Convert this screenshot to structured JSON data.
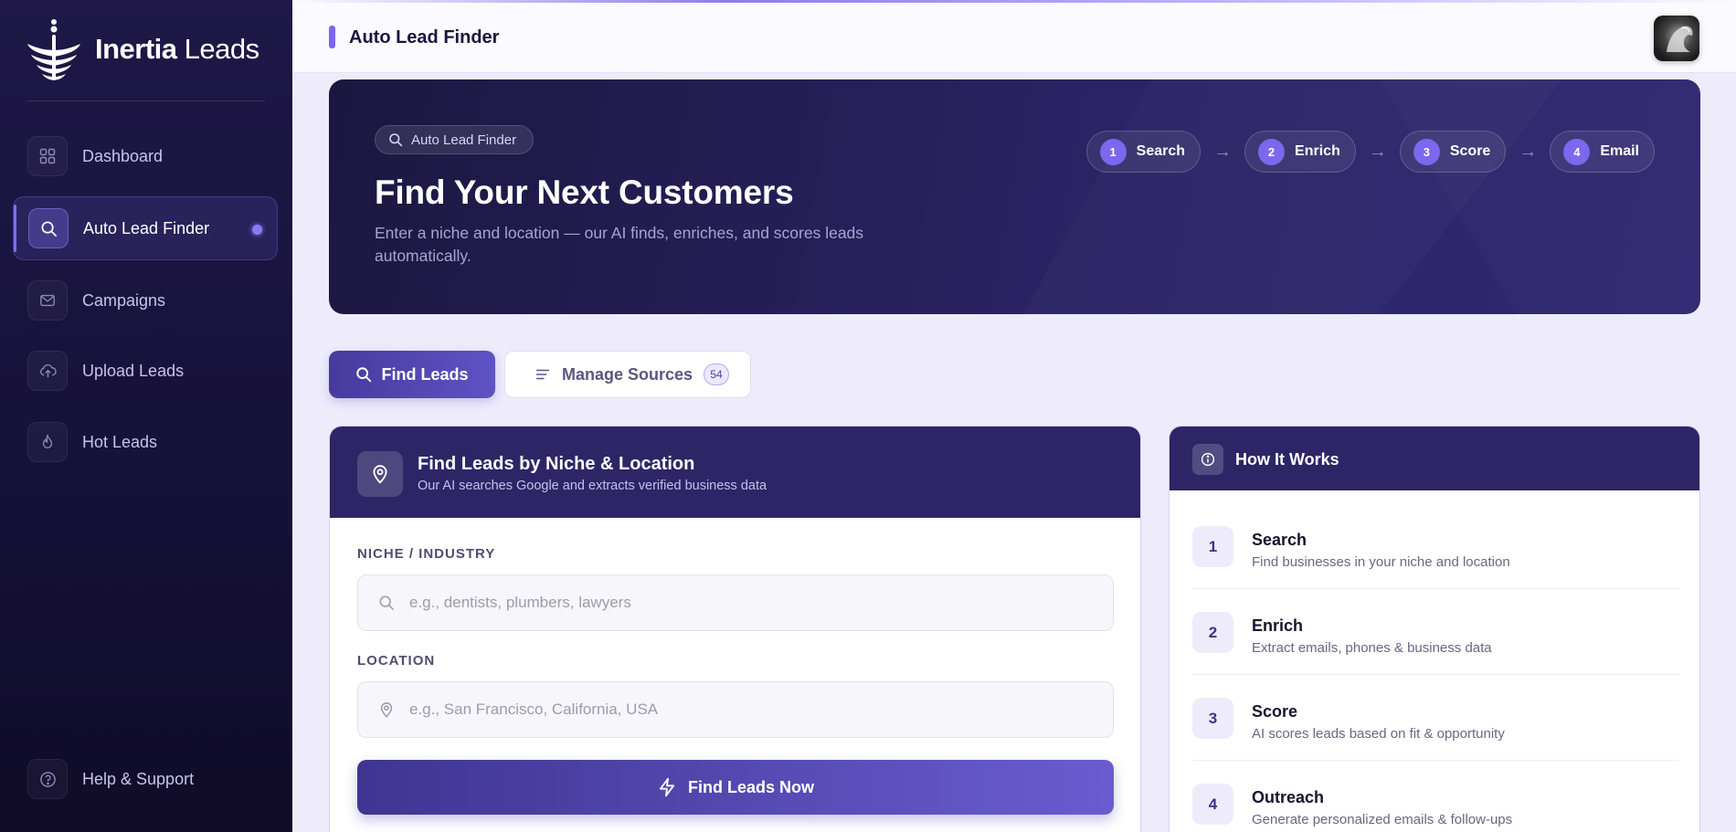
{
  "brand": {
    "name_bold": "Inertia",
    "name_light": "Leads"
  },
  "sidebar": {
    "items": [
      {
        "label": "Dashboard",
        "icon": "grid-icon",
        "active": false
      },
      {
        "label": "Auto Lead Finder",
        "icon": "search-icon",
        "active": true
      },
      {
        "label": "Campaigns",
        "icon": "mail-icon",
        "active": false
      },
      {
        "label": "Upload Leads",
        "icon": "upload-cloud-icon",
        "active": false
      },
      {
        "label": "Hot Leads",
        "icon": "flame-icon",
        "active": false
      }
    ],
    "footer_item": {
      "label": "Help & Support",
      "icon": "help-circle-icon"
    }
  },
  "header": {
    "title": "Auto Lead Finder"
  },
  "hero": {
    "chip": "Auto Lead Finder",
    "title": "Find Your Next Customers",
    "subtitle": "Enter a niche and location — our AI finds, enriches, and scores leads automatically.",
    "steps": [
      {
        "num": "1",
        "label": "Search"
      },
      {
        "num": "2",
        "label": "Enrich"
      },
      {
        "num": "3",
        "label": "Score"
      },
      {
        "num": "4",
        "label": "Email"
      }
    ],
    "arrow": "→"
  },
  "tabs": {
    "find": "Find Leads",
    "manage": "Manage Sources",
    "manage_count": "54"
  },
  "finder": {
    "title": "Find Leads by Niche & Location",
    "subtitle": "Our AI searches Google and extracts verified business data",
    "niche_label": "NICHE / INDUSTRY",
    "niche_placeholder": "e.g., dentists, plumbers, lawyers",
    "location_label": "LOCATION",
    "location_placeholder": "e.g., San Francisco, California, USA",
    "cta": "Find Leads Now"
  },
  "how_it_works": {
    "title": "How It Works",
    "items": [
      {
        "num": "1",
        "title": "Search",
        "desc": "Find businesses in your niche and location"
      },
      {
        "num": "2",
        "title": "Enrich",
        "desc": "Extract emails, phones & business data"
      },
      {
        "num": "3",
        "title": "Score",
        "desc": "AI scores leads based on fit & opportunity"
      },
      {
        "num": "4",
        "title": "Outreach",
        "desc": "Generate personalized emails & follow-ups"
      }
    ]
  },
  "colors": {
    "accent": "#7b68ee",
    "sidebar_bg": "#1a1440",
    "card_head": "#2e2566",
    "page_bg": "#eeebfb"
  }
}
